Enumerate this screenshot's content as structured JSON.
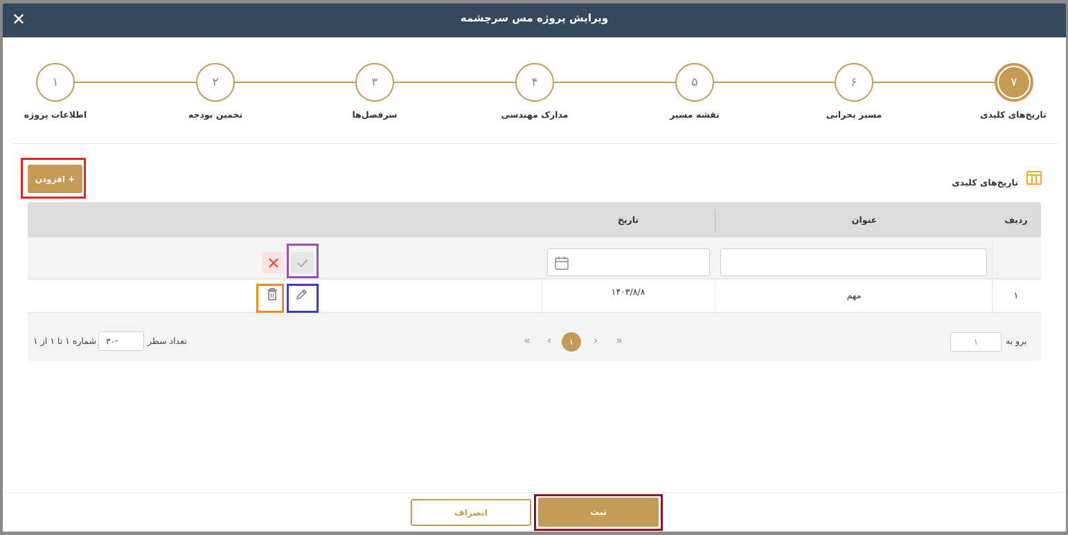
{
  "modal": {
    "title": "ویرایش پروژه مس سرچشمه"
  },
  "stepper": {
    "steps": [
      {
        "number": "۱",
        "label": "اطلاعات پروژه",
        "active": false
      },
      {
        "number": "۲",
        "label": "تخمین بودجه",
        "active": false
      },
      {
        "number": "۳",
        "label": "سرفصل‌ها",
        "active": false
      },
      {
        "number": "۴",
        "label": "مدارک مهندسی",
        "active": false
      },
      {
        "number": "۵",
        "label": "نقشه مسیر",
        "active": false
      },
      {
        "number": "۶",
        "label": "مسیر بحرانی",
        "active": false
      },
      {
        "number": "۷",
        "label": "تاریخ‌های کلیدی",
        "active": true
      }
    ]
  },
  "section": {
    "title": "تاریخ‌های کلیدی",
    "add_label": "+ افزودن"
  },
  "table": {
    "columns": {
      "row": "ردیف",
      "title": "عنوان",
      "date": "تاریخ"
    },
    "rows": [
      {
        "row": "۱",
        "title": "مهم",
        "date": "۱۴۰۳/۸/۸"
      }
    ]
  },
  "pager": {
    "current_page": "۱",
    "rows_label": "تعداد سطر",
    "page_size": "۳۰",
    "info": "شماره ۱ تا ۱ از ۱",
    "goto_label": "برو به",
    "goto_value": "۱"
  },
  "footer": {
    "save_label": "ثبت",
    "cancel_label": "انصراف"
  },
  "colors": {
    "accent": "#c49a55",
    "header": "#34495e",
    "danger": "#e53935"
  }
}
